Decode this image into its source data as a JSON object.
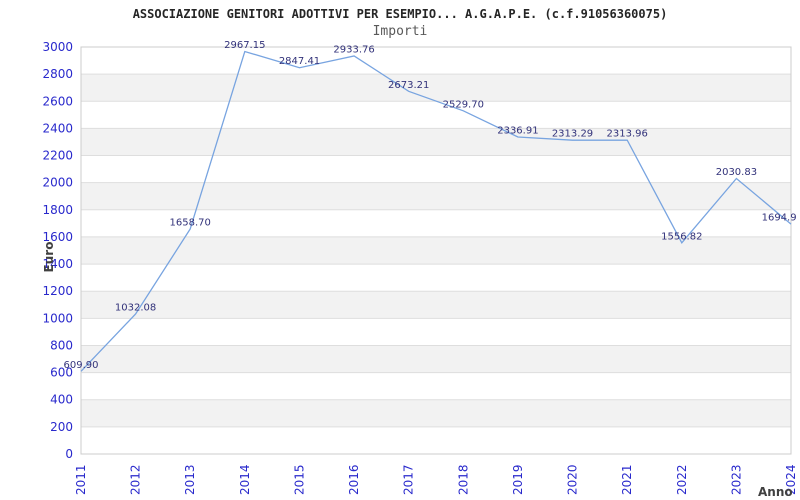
{
  "chart_data": {
    "type": "line",
    "title": "ASSOCIAZIONE GENITORI ADOTTIVI PER ESEMPIO... A.G.A.P.E. (c.f.91056360075)",
    "subtitle": "Importi",
    "xlabel": "Anno",
    "ylabel": "Euro",
    "categories": [
      "2011",
      "2012",
      "2013",
      "2014",
      "2015",
      "2016",
      "2017",
      "2018",
      "2019",
      "2020",
      "2021",
      "2022",
      "2023",
      "2024"
    ],
    "values": [
      609.9,
      1032.08,
      1658.7,
      2967.15,
      2847.41,
      2933.76,
      2673.21,
      2529.7,
      2336.91,
      2313.29,
      2313.96,
      1556.82,
      2030.83,
      1694.9
    ],
    "point_labels": [
      "609.90",
      "1032.08",
      "1658.70",
      "2967.15",
      "2847.41",
      "2933.76",
      "2673.21",
      "2529.70",
      "2336.91",
      "2313.29",
      "2313.96",
      "1556.82",
      "2030.83",
      "1694.9"
    ],
    "y_tick_labels": [
      "0",
      "200",
      "400",
      "600",
      "800",
      "1000",
      "1200",
      "1400",
      "1600",
      "1800",
      "2000",
      "2200",
      "2400",
      "2600",
      "2800",
      "3000"
    ],
    "ylim": [
      0,
      3000
    ],
    "y_tick_step": 200,
    "grid": true,
    "legend_position": "none",
    "x_tick_rotation_degrees": -90,
    "alternating_bands": true
  },
  "colors": {
    "background": "#ffffff",
    "line": "#78a4e0",
    "tick_label": "#2929cc",
    "point_label": "#32327a",
    "band": "#f2f2f2",
    "gridline": "#dedede",
    "plot_border": "#cccccc",
    "title": "#262626",
    "subtitle": "#595959",
    "axis_title": "#404040"
  }
}
